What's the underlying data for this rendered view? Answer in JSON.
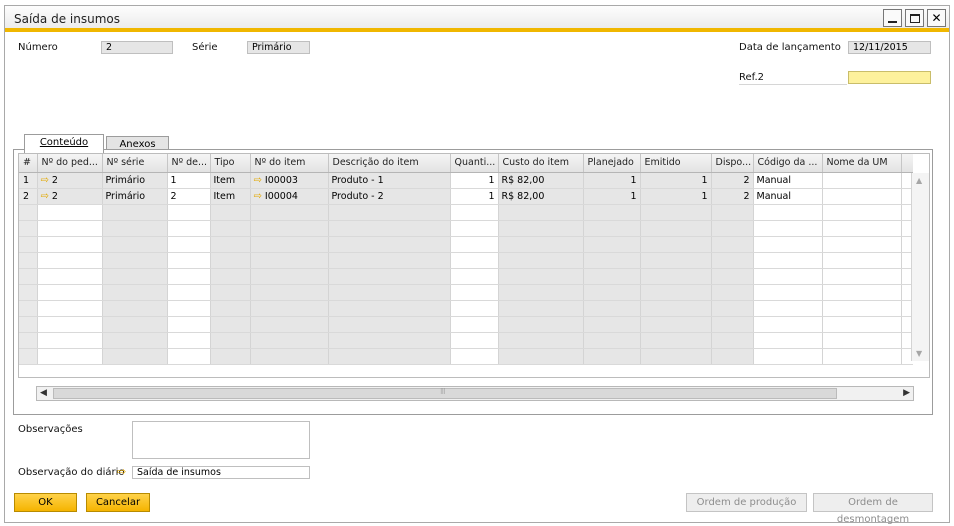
{
  "window": {
    "title": "Saída de insumos"
  },
  "header": {
    "numero_label": "Número",
    "numero_value": "2",
    "serie_label": "Série",
    "serie_value": "Primário",
    "data_label": "Data de lançamento",
    "data_value": "12/11/2015",
    "ref_label": "Ref.2",
    "ref_value": ""
  },
  "tabs": [
    {
      "label": "Conteúdo",
      "active": true
    },
    {
      "label": "Anexos",
      "active": false
    }
  ],
  "table": {
    "columns": [
      "#",
      "Nº do ped...",
      "Nº série",
      "Nº de...",
      "Tipo",
      "Nº do item",
      "Descrição do item",
      "Quanti...",
      "Custo do item",
      "Planejado",
      "Emitido",
      "Dispo...",
      "Código da ...",
      "Nome da UM",
      ""
    ],
    "rows": [
      {
        "n": "1",
        "pedido": "2",
        "serie": "Primário",
        "nde": "1",
        "tipo": "Item",
        "item": "I00003",
        "descricao": "Produto - 1",
        "quantidade": "1",
        "custo": "R$ 82,00",
        "planejado": "1",
        "emitido": "1",
        "disponivel": "2",
        "codigo": "Manual",
        "um": ""
      },
      {
        "n": "2",
        "pedido": "2",
        "serie": "Primário",
        "nde": "2",
        "tipo": "Item",
        "item": "I00004",
        "descricao": "Produto - 2",
        "quantidade": "1",
        "custo": "R$ 82,00",
        "planejado": "1",
        "emitido": "1",
        "disponivel": "2",
        "codigo": "Manual",
        "um": ""
      }
    ]
  },
  "footer": {
    "observacoes_label": "Observações",
    "observacoes_value": "",
    "diario_label": "Observação do diário",
    "diario_value": "Saída de insumos"
  },
  "buttons": {
    "ok": "OK",
    "cancel": "Cancelar",
    "production": "Ordem de produção",
    "disassembly": "Ordem de desmontagem"
  },
  "colors": {
    "accent": "#f0b700",
    "arrow": "#e3a800",
    "ref_field": "#fdf19c"
  },
  "icons": {
    "link_arrow": "arrow-right-icon",
    "close": "close-icon",
    "minimize": "minimize-icon",
    "maximize": "maximize-icon"
  }
}
